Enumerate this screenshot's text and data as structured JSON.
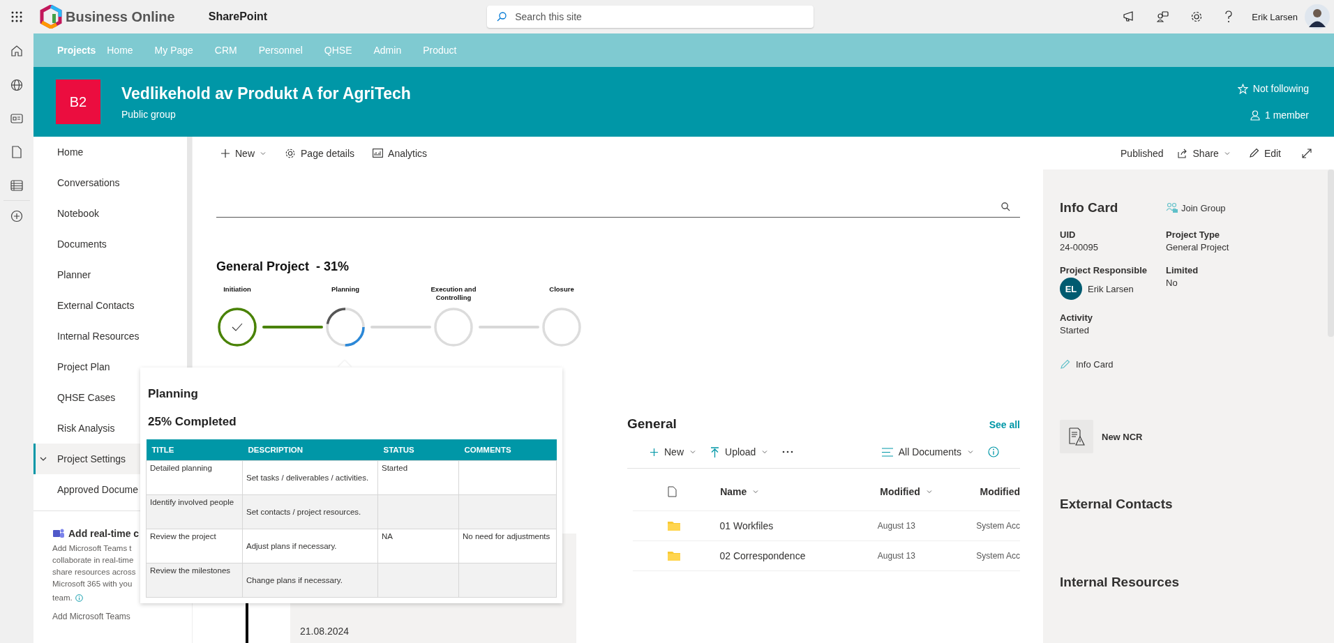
{
  "app_bar": {
    "brand": "Business Online",
    "product": "SharePoint",
    "search": {
      "placeholder": "Search this site"
    },
    "user": "Erik Larsen"
  },
  "hub_nav": [
    {
      "label": "Projects",
      "selected": true
    },
    {
      "label": "Home",
      "selected": false
    },
    {
      "label": "My Page",
      "selected": false
    },
    {
      "label": "CRM",
      "selected": false
    },
    {
      "label": "Personnel",
      "selected": false
    },
    {
      "label": "QHSE",
      "selected": false
    },
    {
      "label": "Admin",
      "selected": false
    },
    {
      "label": "Product",
      "selected": false
    }
  ],
  "site_header": {
    "logo": "B2",
    "title": "Vedlikehold av Produkt A for AgriTech",
    "subtitle": "Public group",
    "follow": "Not following",
    "members": "1 member"
  },
  "left_nav": {
    "items": [
      {
        "label": "Home",
        "selected": false
      },
      {
        "label": "Conversations",
        "selected": false
      },
      {
        "label": "Notebook",
        "selected": false
      },
      {
        "label": "Documents",
        "selected": false
      },
      {
        "label": "Planner",
        "selected": false
      },
      {
        "label": "External Contacts",
        "selected": false
      },
      {
        "label": "Internal Resources",
        "selected": false
      },
      {
        "label": "Project Plan",
        "selected": false
      },
      {
        "label": "QHSE Cases",
        "selected": false
      },
      {
        "label": "Risk Analysis",
        "selected": false
      },
      {
        "label": "Project Settings",
        "selected": true,
        "expanded": true
      },
      {
        "label": "Approved Docume",
        "selected": false
      }
    ],
    "teams_promo": {
      "title": "Add real-time c",
      "lines": [
        "Add Microsoft Teams t",
        "collaborate in real-time",
        "share resources across",
        "Microsoft 365 with you",
        "team."
      ],
      "link": "Add Microsoft Teams"
    }
  },
  "command_bar": {
    "new": "New",
    "page_details": "Page details",
    "analytics": "Analytics",
    "status": "Published",
    "share": "Share",
    "edit": "Edit"
  },
  "progress": {
    "title": "General Project  - 31%",
    "steps": [
      {
        "label": "Initiation",
        "kind": "done"
      },
      {
        "label": "Planning",
        "kind": "current"
      },
      {
        "label": "Execution and Controlling",
        "kind": "pending"
      },
      {
        "label": "Closure",
        "kind": "pending"
      }
    ]
  },
  "popup": {
    "title": "Planning",
    "completed": "25% Completed",
    "columns": [
      "TITLE",
      "DESCRIPTION",
      "STATUS",
      "COMMENTS"
    ],
    "rows": [
      [
        "Detailed planning",
        "Set tasks / deliverables / activities.",
        "Started",
        ""
      ],
      [
        "Identify involved people",
        "Set contacts / project resources.",
        "",
        ""
      ],
      [
        "Review the project",
        "Adjust plans if necessary.",
        "NA",
        "No need for adjustments"
      ],
      [
        "Review the milestones",
        "Change plans if necessary.",
        "",
        ""
      ]
    ]
  },
  "timeline": {
    "date": "21.08.2024"
  },
  "documents": {
    "title": "General",
    "see_all": "See all",
    "new": "New",
    "upload": "Upload",
    "view": "All Documents",
    "columns": [
      "Name",
      "Modified",
      "Modified"
    ],
    "rows": [
      {
        "name": "01 Workfiles",
        "modified": "August 13",
        "modified_by": "System Acc"
      },
      {
        "name": "02 Correspondence",
        "modified": "August 13",
        "modified_by": "System Acc"
      }
    ]
  },
  "info_card": {
    "title": "Info Card",
    "join": "Join Group",
    "fields": [
      {
        "label": "UID",
        "value": "24-00095",
        "kind": "text"
      },
      {
        "label": "Project Type",
        "value": "General Project",
        "kind": "text"
      },
      {
        "label": "Project Responsible",
        "value": "Erik Larsen",
        "initials": "EL",
        "kind": "person"
      },
      {
        "label": "Limited",
        "value": "No",
        "kind": "text"
      },
      {
        "label": "Activity",
        "value": "Started",
        "kind": "text"
      }
    ],
    "edit": "Info Card",
    "new_ncr": "New NCR",
    "external": "External Contacts",
    "internal": "Internal Resources"
  }
}
